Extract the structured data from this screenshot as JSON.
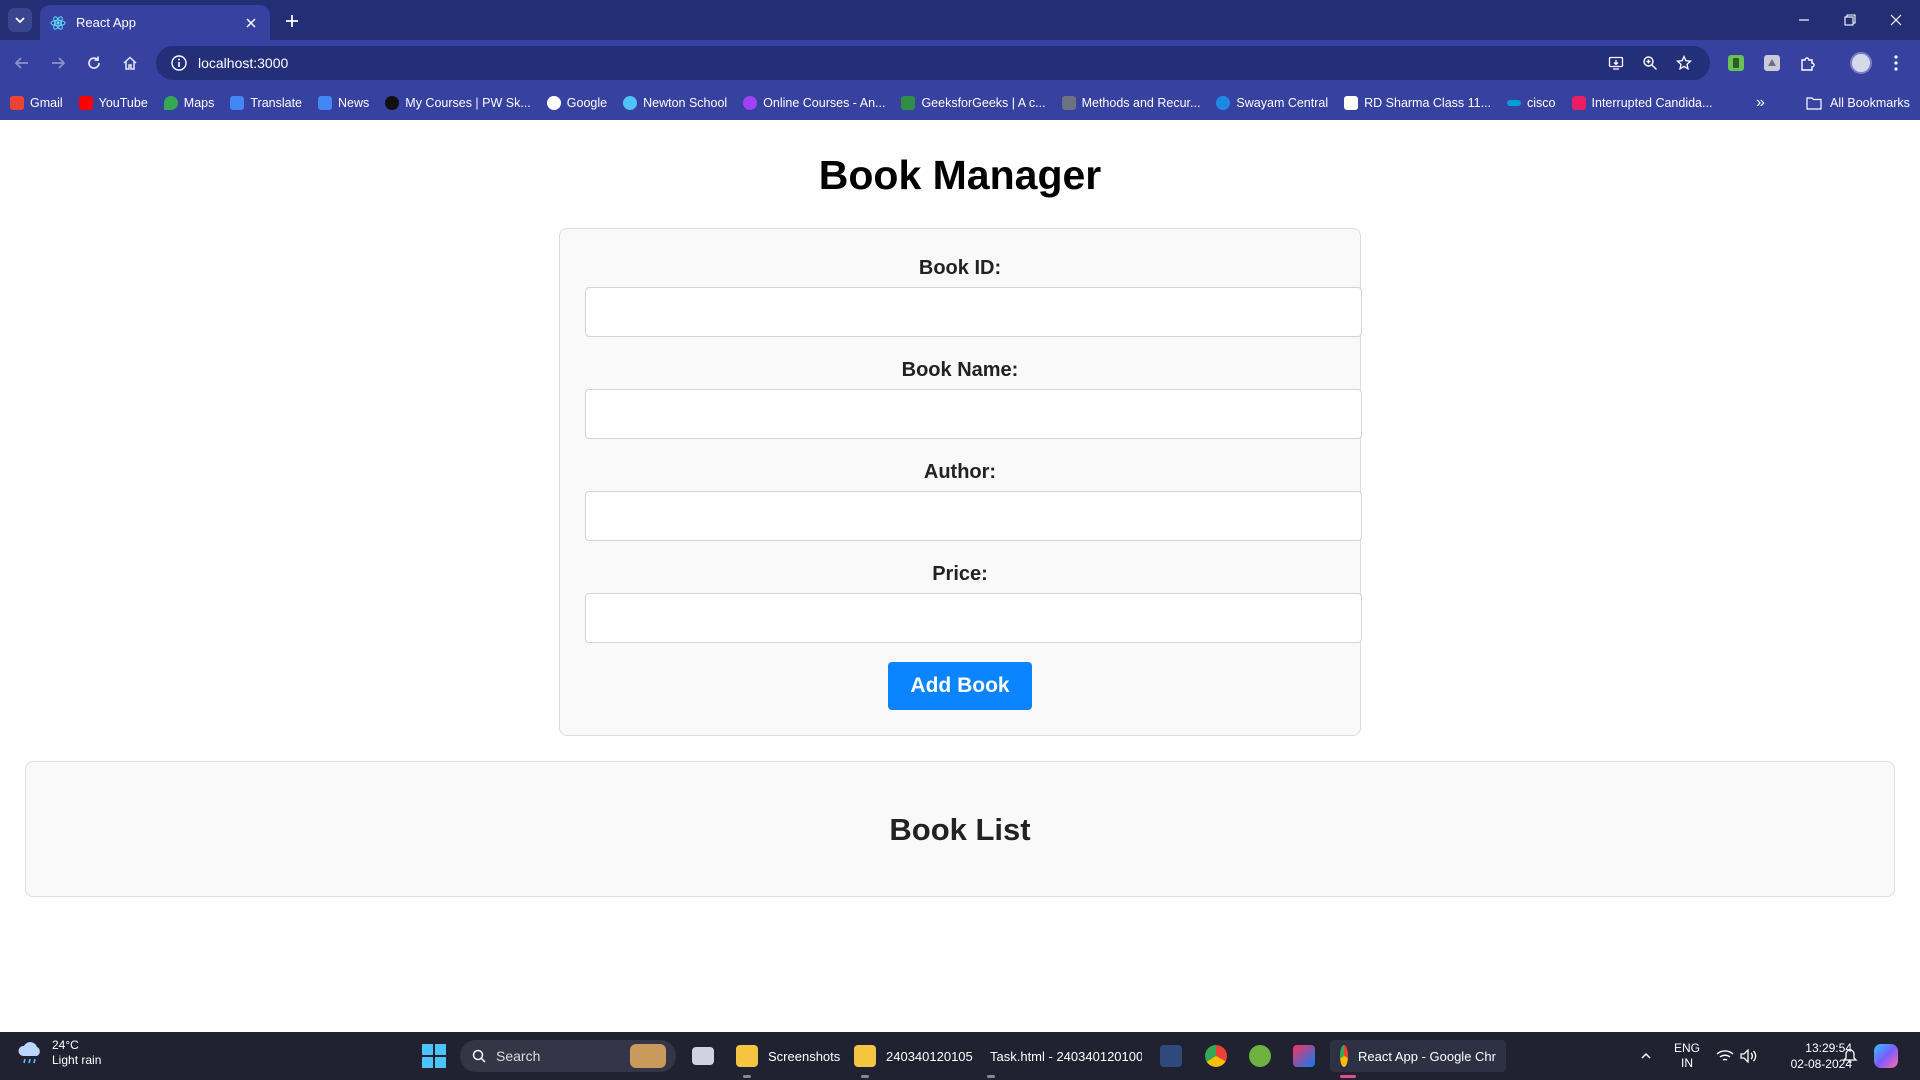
{
  "browser": {
    "tab_title": "React App",
    "url": "localhost:3000",
    "bookmarks": [
      {
        "label": "Gmail",
        "color": "#ea4335"
      },
      {
        "label": "YouTube",
        "color": "#ff0000"
      },
      {
        "label": "Maps",
        "color": "#34a853"
      },
      {
        "label": "Translate",
        "color": "#4285f4"
      },
      {
        "label": "News",
        "color": "#4285f4"
      },
      {
        "label": "My Courses | PW Sk...",
        "color": "#111111"
      },
      {
        "label": "Google",
        "color": "#ffffff"
      },
      {
        "label": "Newton School",
        "color": "#4fc3f7"
      },
      {
        "label": "Online Courses - An...",
        "color": "#a142f4"
      },
      {
        "label": "GeeksforGeeks | A c...",
        "color": "#2f8d46"
      },
      {
        "label": "Methods and Recur...",
        "color": "#6b7280"
      },
      {
        "label": "Swayam Central",
        "color": "#1e88e5"
      },
      {
        "label": "RD Sharma Class 11...",
        "color": "#ffffff"
      },
      {
        "label": "cisco",
        "color": "#049fd9"
      },
      {
        "label": "Interrupted Candida...",
        "color": "#e91e63"
      }
    ],
    "all_bookmarks_label": "All Bookmarks"
  },
  "page": {
    "title": "Book Manager",
    "form": {
      "book_id_label": "Book ID:",
      "book_name_label": "Book Name:",
      "author_label": "Author:",
      "price_label": "Price:",
      "book_id_value": "",
      "book_name_value": "",
      "author_value": "",
      "price_value": "",
      "submit_label": "Add Book"
    },
    "list": {
      "title": "Book List"
    }
  },
  "taskbar": {
    "weather_temp": "24°C",
    "weather_desc": "Light rain",
    "search_placeholder": "Search",
    "apps": [
      {
        "label": "Screenshots"
      },
      {
        "label": "240340120105"
      },
      {
        "label": "Task.html - 240340120100"
      },
      {
        "label": "React App - Google Chr"
      }
    ],
    "lang_top": "ENG",
    "lang_bottom": "IN",
    "time": "13:29:54",
    "date": "02-08-2024"
  },
  "colors": {
    "accent_button": "#0a84ff",
    "chrome_bar": "#3641a0"
  }
}
